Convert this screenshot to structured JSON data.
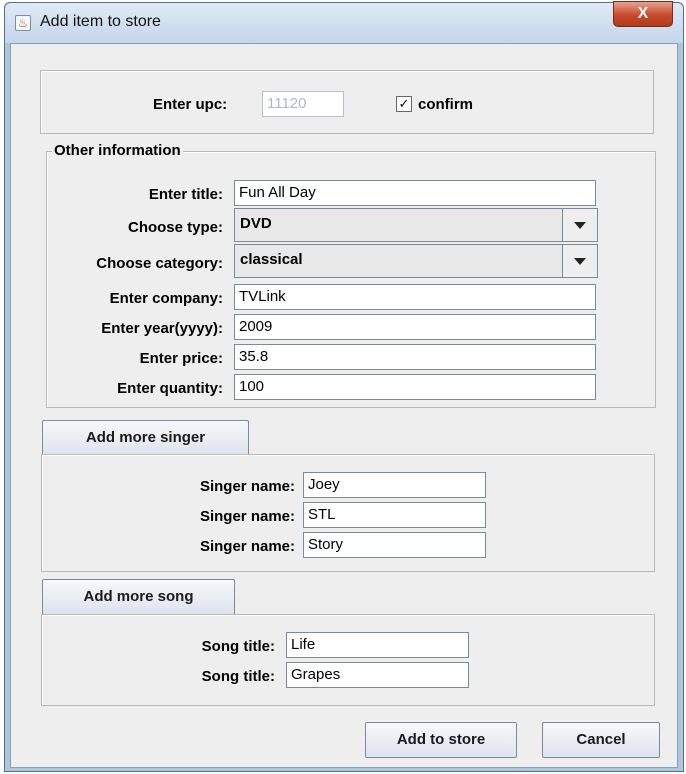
{
  "window": {
    "title": "Add item to store",
    "close_glyph": "X",
    "app_icon": "java-app-icon"
  },
  "upc": {
    "label": "Enter upc:",
    "value": "11120",
    "confirm_label": "confirm",
    "confirm_checked": true,
    "check_glyph": "✓"
  },
  "other_info": {
    "legend": "Other information",
    "title_label": "Enter title:",
    "title_value": "Fun All Day",
    "type_label": "Choose type:",
    "type_value": "DVD",
    "category_label": "Choose category:",
    "category_value": "classical",
    "company_label": "Enter company:",
    "company_value": "TVLink",
    "year_label": "Enter year(yyyy):",
    "year_value": "2009",
    "price_label": "Enter price:",
    "price_value": "35.8",
    "quantity_label": "Enter quantity:",
    "quantity_value": "100"
  },
  "singers": {
    "add_button": "Add more singer",
    "items": [
      {
        "label": "Singer name:",
        "value": "Joey"
      },
      {
        "label": "Singer name:",
        "value": "STL"
      },
      {
        "label": "Singer name:",
        "value": "Story"
      }
    ]
  },
  "songs": {
    "add_button": "Add more song",
    "items": [
      {
        "label": "Song title:",
        "value": "Life"
      },
      {
        "label": "Song title:",
        "value": "Grapes"
      }
    ]
  },
  "actions": {
    "add_to_store": "Add to store",
    "cancel": "Cancel"
  }
}
